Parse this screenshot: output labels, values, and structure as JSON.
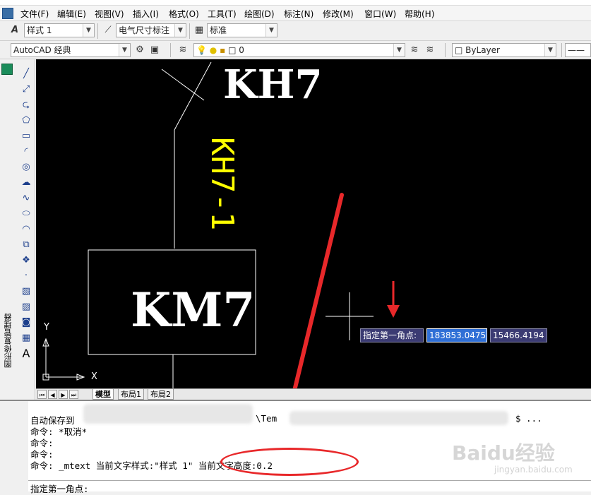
{
  "menu": {
    "items": [
      "文件(F)",
      "编辑(E)",
      "视图(V)",
      "插入(I)",
      "格式(O)",
      "工具(T)",
      "绘图(D)",
      "标注(N)",
      "修改(M)",
      "窗口(W)",
      "帮助(H)"
    ]
  },
  "toolbar1": {
    "text_style": "样式 1",
    "dim_style": "电气尺寸标注",
    "table_style": "标准"
  },
  "toolbar2": {
    "workspace": "AutoCAD 经典",
    "layer": "0",
    "color": "ByLayer"
  },
  "side_panel": {
    "label": "图形修复管理器"
  },
  "drawing": {
    "text_kh7": "KH7",
    "text_kh7_1": "KH7-1",
    "text_km7": "KM7",
    "axis_y": "Y",
    "axis_x": "X"
  },
  "dynamic_input": {
    "prompt": "指定第一角点:",
    "x_value": "183853.0475",
    "y_value": "15466.4194"
  },
  "layout_tabs": [
    "模型",
    "布局1",
    "布局2"
  ],
  "command_history": [
    "自动保存到",
    "命令: *取消*",
    "命令:",
    "命令:",
    "命令: _mtext 当前文字样式:\"样式 1\"  当前文字高度:0.2"
  ],
  "command_fragments": {
    "temp_path": "\\Tem",
    "tail": "$ ..."
  },
  "command_prompt": "指定第一角点:",
  "watermark": {
    "main": "Baidu经验",
    "sub": "jingyan.baidu.com"
  },
  "colors": {
    "canvas_bg": "#000000",
    "yellow_text": "#ffff00",
    "white_text": "#ffffff",
    "annotation_red": "#e8282a",
    "dyn_input_bg": "#3b3b73",
    "dyn_input_active": "#2f6fd6"
  }
}
